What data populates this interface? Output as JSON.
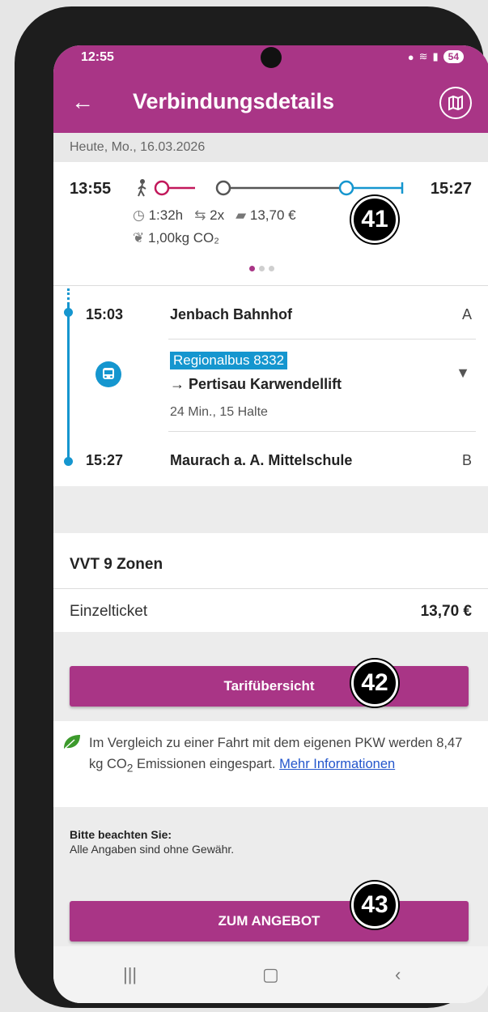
{
  "status_bar": {
    "time": "12:55",
    "battery": "54"
  },
  "app_bar": {
    "title": "Verbindungsdetails"
  },
  "date": "Heute, Mo., 16.03.2026",
  "summary": {
    "departure": "13:55",
    "arrival": "15:27",
    "duration": "1:32h",
    "transfers": "2x",
    "price": "13,70 €",
    "co2": "1,00kg CO₂",
    "page_dots": 3,
    "active_dot": 1
  },
  "legs": {
    "start_time": "15:03",
    "start_stop": "Jenbach Bahnhof",
    "start_platform": "A",
    "line": "Regionalbus 8332",
    "direction": "→ Pertisau Karwendellift",
    "info": "24 Min., 15 Halte",
    "end_time": "15:27",
    "end_stop": "Maurach a. A. Mittelschule",
    "end_platform": "B"
  },
  "tariff": {
    "zone": "VVT 9 Zonen",
    "ticket_name": "Einzelticket",
    "ticket_price": "13,70 €",
    "overview_button": "Tarifübersicht"
  },
  "eco": {
    "text_before": "Im Vergleich zu einer Fahrt mit dem eigenen PKW werden 8,47 kg CO",
    "subscript": "2",
    "text_after": " Emissionen eingespart. ",
    "link": "Mehr Informationen"
  },
  "notice": {
    "title": "Bitte beachten Sie:",
    "text": "Alle Angaben sind ohne Gewähr."
  },
  "cta_button": "ZUM ANGEBOT",
  "annotations": {
    "a1": "41",
    "a2": "42",
    "a3": "43"
  },
  "colors": {
    "brand": "#a93586",
    "bus": "#1596cf",
    "walk": "#c2185b",
    "train": "#555555"
  }
}
